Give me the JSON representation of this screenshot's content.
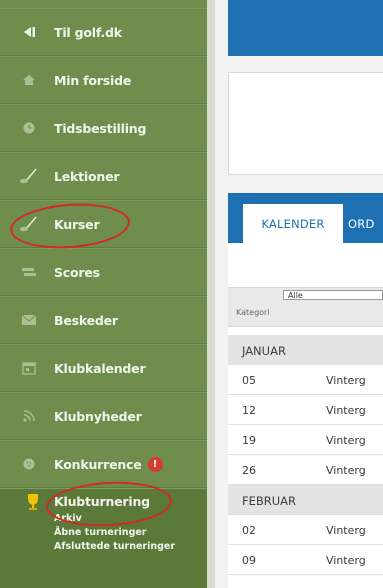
{
  "sidebar": {
    "items": [
      {
        "label": "Til golf.dk",
        "icon": "back-arrow-icon"
      },
      {
        "label": "Min forside",
        "icon": "home-icon"
      },
      {
        "label": "Tidsbestilling",
        "icon": "clock-icon"
      },
      {
        "label": "Lektioner",
        "icon": "golf-club-icon"
      },
      {
        "label": "Kurser",
        "icon": "golf-club-icon"
      },
      {
        "label": "Scores",
        "icon": "scores-icon"
      },
      {
        "label": "Beskeder",
        "icon": "envelope-icon"
      },
      {
        "label": "Klubkalender",
        "icon": "calendar-icon"
      },
      {
        "label": "Klubnyheder",
        "icon": "rss-icon"
      },
      {
        "label": "Konkurrence",
        "icon": "golf-ball-icon",
        "badge": "!"
      },
      {
        "label": "Klubturnering",
        "icon": "trophy-icon"
      }
    ],
    "sub_items": [
      "Arkiv",
      "Åbne turneringer",
      "Afsluttede turneringer"
    ]
  },
  "main": {
    "tabs": [
      "KALENDER",
      "ORD"
    ],
    "filter": {
      "select_value": "Alle",
      "label": "Kategori"
    },
    "rows": [
      {
        "type": "month",
        "label": "JANUAR"
      },
      {
        "type": "event",
        "day": "05",
        "name": "Vinterg"
      },
      {
        "type": "event",
        "day": "12",
        "name": "Vinterg"
      },
      {
        "type": "event",
        "day": "19",
        "name": "Vinterg"
      },
      {
        "type": "event",
        "day": "26",
        "name": "Vinterg"
      },
      {
        "type": "month",
        "label": "FEBRUAR"
      },
      {
        "type": "event",
        "day": "02",
        "name": "Vinterg"
      },
      {
        "type": "event",
        "day": "09",
        "name": "Vinterg"
      }
    ]
  },
  "colors": {
    "sidebar_bg": "#6f8d4d",
    "accent_blue": "#1f6fb3",
    "annotation_red": "#d62626"
  }
}
